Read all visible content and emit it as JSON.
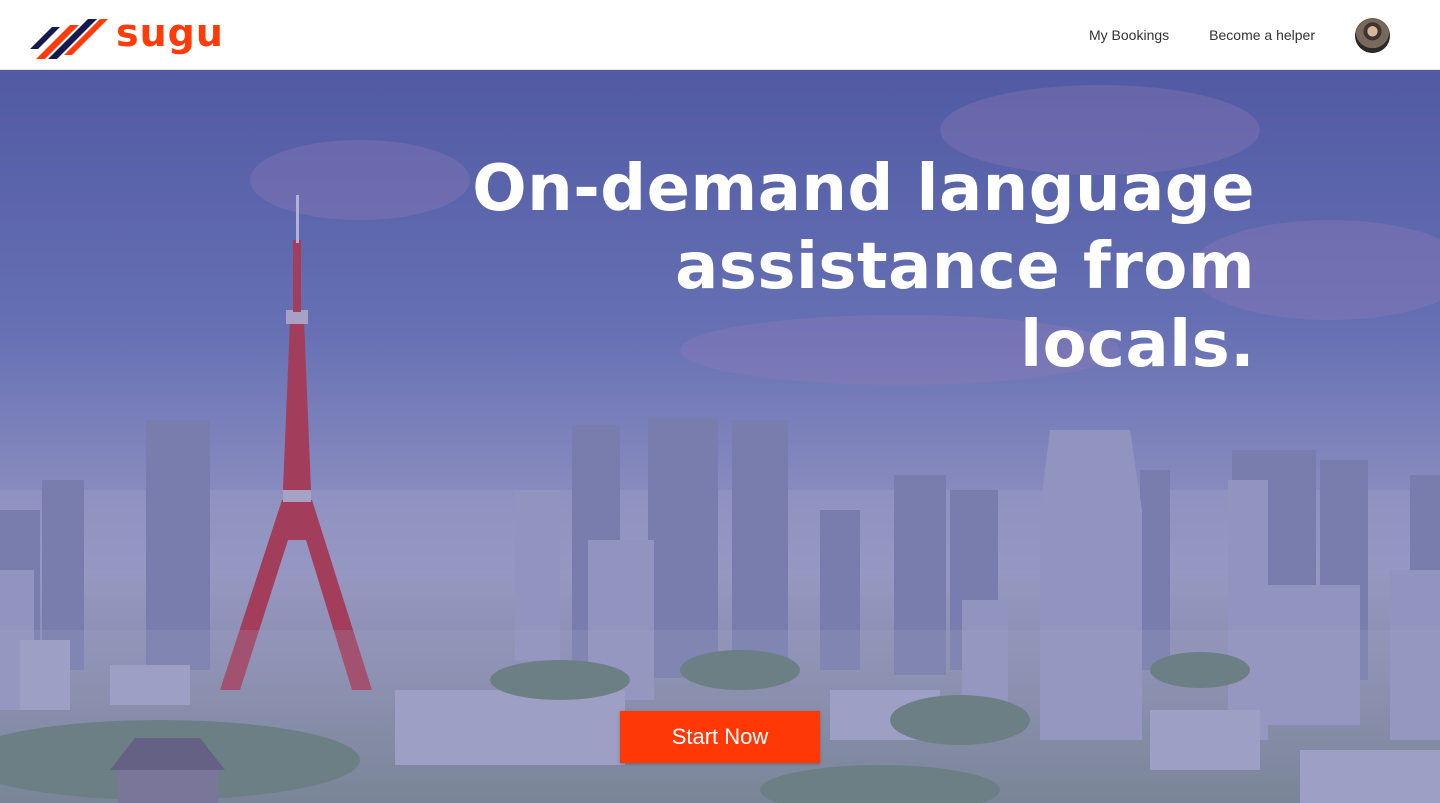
{
  "brand": {
    "name": "sugu",
    "logo_icon": "sugu-stripes-logo-icon",
    "primary_color": "#ff3b0a",
    "secondary_color": "#141a4e"
  },
  "nav": {
    "my_bookings": "My Bookings",
    "become_helper": "Become a helper",
    "avatar_icon": "user-avatar"
  },
  "hero": {
    "headline": "On-demand language assistance from locals.",
    "cta_label": "Start Now",
    "cta_color": "#ff3806",
    "background_image": "tokyo-skyline-with-tower"
  }
}
